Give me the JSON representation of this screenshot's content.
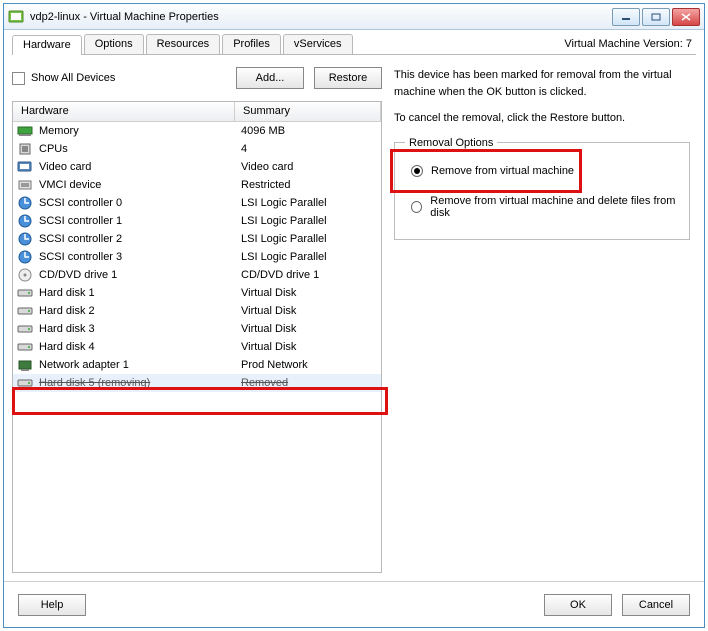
{
  "window": {
    "title": "vdp2-linux - Virtual Machine Properties"
  },
  "tabs": [
    "Hardware",
    "Options",
    "Resources",
    "Profiles",
    "vServices"
  ],
  "active_tab": 0,
  "version_label": "Virtual Machine Version: 7",
  "show_all_label": "Show All Devices",
  "buttons": {
    "add": "Add...",
    "restore": "Restore",
    "help": "Help",
    "ok": "OK",
    "cancel": "Cancel"
  },
  "columns": {
    "hardware": "Hardware",
    "summary": "Summary"
  },
  "hardware": [
    {
      "icon": "memory",
      "name": "Memory",
      "summary": "4096 MB"
    },
    {
      "icon": "cpu",
      "name": "CPUs",
      "summary": "4"
    },
    {
      "icon": "video",
      "name": "Video card",
      "summary": "Video card"
    },
    {
      "icon": "vmci",
      "name": "VMCI device",
      "summary": "Restricted"
    },
    {
      "icon": "scsi",
      "name": "SCSI controller 0",
      "summary": "LSI Logic Parallel"
    },
    {
      "icon": "scsi",
      "name": "SCSI controller 1",
      "summary": "LSI Logic Parallel"
    },
    {
      "icon": "scsi",
      "name": "SCSI controller 2",
      "summary": "LSI Logic Parallel"
    },
    {
      "icon": "scsi",
      "name": "SCSI controller 3",
      "summary": "LSI Logic Parallel"
    },
    {
      "icon": "cd",
      "name": "CD/DVD drive 1",
      "summary": "CD/DVD drive 1"
    },
    {
      "icon": "disk",
      "name": "Hard disk 1",
      "summary": "Virtual Disk"
    },
    {
      "icon": "disk",
      "name": "Hard disk 2",
      "summary": "Virtual Disk"
    },
    {
      "icon": "disk",
      "name": "Hard disk 3",
      "summary": "Virtual Disk"
    },
    {
      "icon": "disk",
      "name": "Hard disk 4",
      "summary": "Virtual Disk"
    },
    {
      "icon": "nic",
      "name": "Network adapter 1",
      "summary": "Prod Network"
    },
    {
      "icon": "disk",
      "name": "Hard disk 5 (removing)",
      "summary": "Removed",
      "removing": true,
      "selected": true
    }
  ],
  "right": {
    "info1": "This device has been marked for removal from the virtual machine when the OK button is clicked.",
    "info2": "To cancel the removal, click the Restore button.",
    "removal_legend": "Removal Options",
    "opt1": "Remove from virtual machine",
    "opt2": "Remove from virtual machine and delete files from disk",
    "selected_option": 0
  }
}
